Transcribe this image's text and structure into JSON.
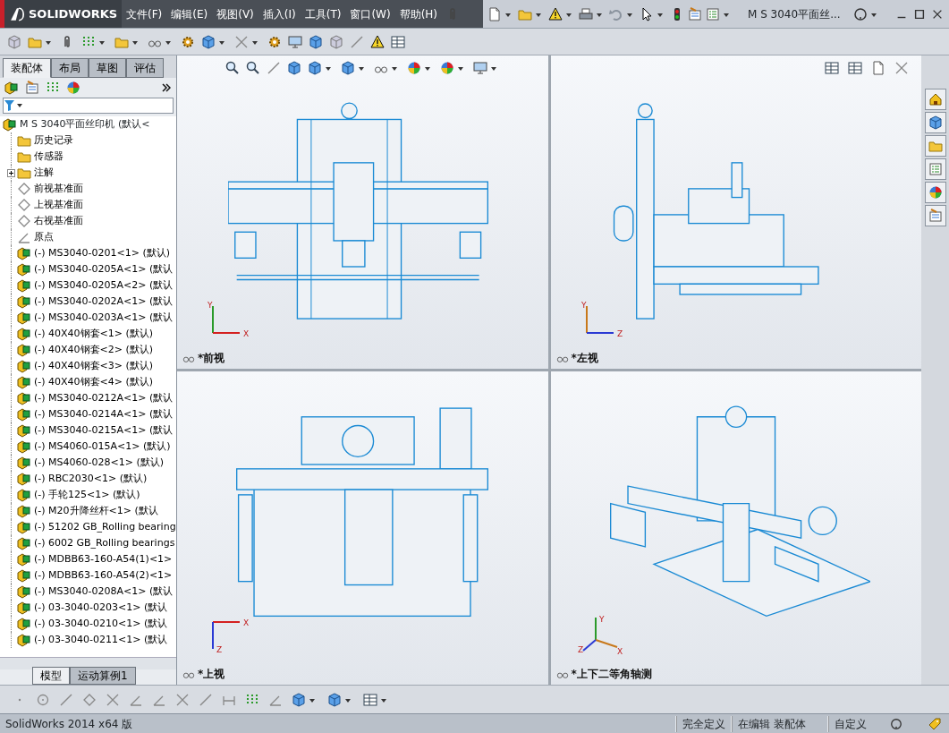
{
  "app": {
    "logo": "SOLIDWORKS",
    "document_title": "M S 3040平面丝...",
    "menus": [
      "文件(F)",
      "编辑(E)",
      "视图(V)",
      "插入(I)",
      "工具(T)",
      "窗口(W)",
      "帮助(H)"
    ]
  },
  "command_tabs": [
    {
      "label": "装配体",
      "selected": true
    },
    {
      "label": "布局",
      "selected": false
    },
    {
      "label": "草图",
      "selected": false
    },
    {
      "label": "评估",
      "selected": false
    }
  ],
  "tree": {
    "root": "M S 3040平面丝印机 (默认<",
    "items": [
      {
        "kind": "history",
        "label": "历史记录"
      },
      {
        "kind": "sensor",
        "label": "传感器"
      },
      {
        "kind": "annotation",
        "label": "注解",
        "expanded": false
      },
      {
        "kind": "plane",
        "label": "前视基准面"
      },
      {
        "kind": "plane",
        "label": "上视基准面"
      },
      {
        "kind": "plane",
        "label": "右视基准面"
      },
      {
        "kind": "origin",
        "label": "原点"
      },
      {
        "kind": "part",
        "label": "(-) MS3040-0201<1> (默认)"
      },
      {
        "kind": "part",
        "label": "(-) MS3040-0205A<1> (默认"
      },
      {
        "kind": "part",
        "label": "(-) MS3040-0205A<2> (默认"
      },
      {
        "kind": "part",
        "label": "(-) MS3040-0202A<1> (默认"
      },
      {
        "kind": "part",
        "label": "(-) MS3040-0203A<1> (默认"
      },
      {
        "kind": "part",
        "label": "(-) 40X40钢套<1> (默认)"
      },
      {
        "kind": "part",
        "label": "(-) 40X40钢套<2> (默认)"
      },
      {
        "kind": "part",
        "label": "(-) 40X40钢套<3> (默认)"
      },
      {
        "kind": "part",
        "label": "(-) 40X40钢套<4> (默认)"
      },
      {
        "kind": "part",
        "label": "(-) MS3040-0212A<1> (默认"
      },
      {
        "kind": "part",
        "label": "(-) MS3040-0214A<1> (默认"
      },
      {
        "kind": "part",
        "label": "(-) MS3040-0215A<1> (默认"
      },
      {
        "kind": "part",
        "label": "(-) MS4060-015A<1> (默认)"
      },
      {
        "kind": "part",
        "label": "(-) MS4060-028<1> (默认)"
      },
      {
        "kind": "part",
        "label": "(-) RBC2030<1> (默认)"
      },
      {
        "kind": "part",
        "label": "(-) 手轮125<1> (默认)"
      },
      {
        "kind": "part",
        "label": "(-) M20升降丝杆<1> (默认"
      },
      {
        "kind": "part",
        "label": "(-) 51202 GB_Rolling bearing"
      },
      {
        "kind": "part",
        "label": "(-) 6002 GB_Rolling bearings"
      },
      {
        "kind": "part",
        "label": "(-) MDBB63-160-A54(1)<1>"
      },
      {
        "kind": "part",
        "label": "(-) MDBB63-160-A54(2)<1>"
      },
      {
        "kind": "part",
        "label": "(-) MS3040-0208A<1> (默认"
      },
      {
        "kind": "part",
        "label": "(-) 03-3040-0203<1> (默认"
      },
      {
        "kind": "part",
        "label": "(-) 03-3040-0210<1> (默认"
      },
      {
        "kind": "part",
        "label": "(-) 03-3040-0211<1> (默认"
      }
    ]
  },
  "views": [
    {
      "kind": "front",
      "label": "*前视",
      "axis_labels": [
        "Y",
        "X"
      ]
    },
    {
      "kind": "left",
      "label": "*左视",
      "axis_labels": [
        "Y",
        "Z"
      ]
    },
    {
      "kind": "top",
      "label": "*上视",
      "axis_labels": [
        "X",
        "Z"
      ]
    },
    {
      "kind": "iso",
      "label": "*上下二等角轴测",
      "axis_labels": [
        "Y",
        "X",
        "Z"
      ]
    }
  ],
  "sheet_tabs": [
    {
      "label": "模型",
      "selected": true
    },
    {
      "label": "运动算例1",
      "selected": false
    }
  ],
  "status_bar": {
    "version": "SolidWorks 2014 x64 版",
    "definition": "完全定义",
    "editing": "在编辑 装配体",
    "units": "自定义"
  }
}
